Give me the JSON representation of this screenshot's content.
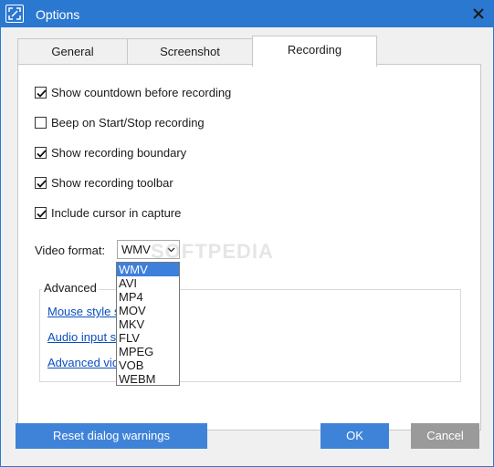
{
  "window": {
    "title": "Options",
    "accent": "#2b78d1"
  },
  "tabs": [
    {
      "label": "General"
    },
    {
      "label": "Screenshot"
    },
    {
      "label": "Recording",
      "active": true
    }
  ],
  "recording": {
    "options": [
      {
        "label": "Show countdown before recording",
        "checked": true
      },
      {
        "label": "Beep on Start/Stop recording",
        "checked": false
      },
      {
        "label": "Show recording boundary",
        "checked": true
      },
      {
        "label": "Show recording toolbar",
        "checked": true
      },
      {
        "label": "Include cursor in capture",
        "checked": true
      }
    ],
    "video_format": {
      "label": "Video format:",
      "selected": "WMV",
      "options": [
        "WMV",
        "AVI",
        "MP4",
        "MOV",
        "MKV",
        "FLV",
        "MPEG",
        "VOB",
        "WEBM"
      ]
    },
    "advanced": {
      "label": "Advanced",
      "links": [
        "Mouse style se",
        "Audio input se",
        "Advanced vid"
      ]
    }
  },
  "watermark": "SOFTPEDIA",
  "buttons": {
    "reset": "Reset dialog warnings",
    "ok": "OK",
    "cancel": "Cancel"
  }
}
